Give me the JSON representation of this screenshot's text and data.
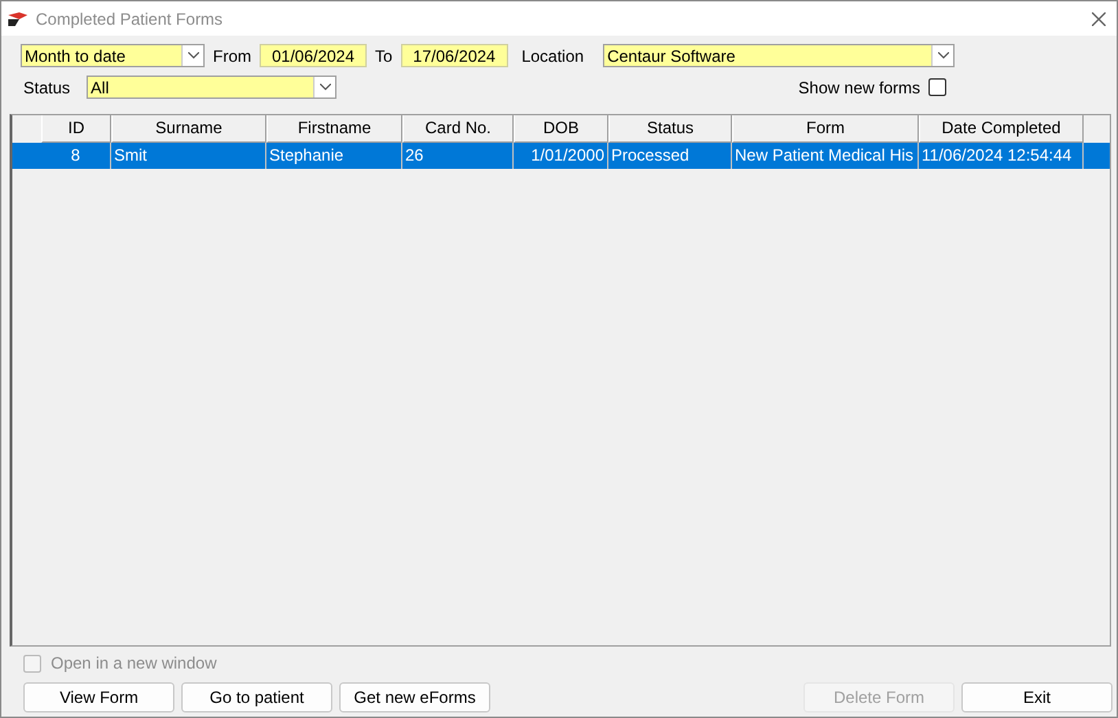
{
  "window": {
    "title": "Completed Patient Forms"
  },
  "filters": {
    "period": "Month to date",
    "from_label": "From",
    "from": "01/06/2024",
    "to_label": "To",
    "to": "17/06/2024",
    "location_label": "Location",
    "location": "Centaur Software",
    "status_label": "Status",
    "status": "All",
    "show_new_forms": {
      "label": "Show new forms",
      "checked": false
    }
  },
  "table": {
    "columns": [
      "ID",
      "Surname",
      "Firstname",
      "Card No.",
      "DOB",
      "Status",
      "Form",
      "Date Completed"
    ],
    "rows": [
      {
        "selected": true,
        "cells": [
          "8",
          "Smit",
          "Stephanie",
          "26",
          "1/01/2000",
          "Processed",
          "New Patient Medical His",
          "11/06/2024 12:54:44"
        ]
      }
    ]
  },
  "open_in_new_window": {
    "label": "Open in a new window",
    "checked": false,
    "disabled": true
  },
  "buttons": [
    {
      "label": "View Form",
      "disabled": false
    },
    {
      "label": "Go to patient",
      "disabled": false
    },
    {
      "label": "Get new eForms",
      "disabled": false
    }
  ],
  "right_buttons": [
    {
      "label": "Delete Form",
      "disabled": true
    },
    {
      "label": "Exit",
      "disabled": false
    }
  ]
}
